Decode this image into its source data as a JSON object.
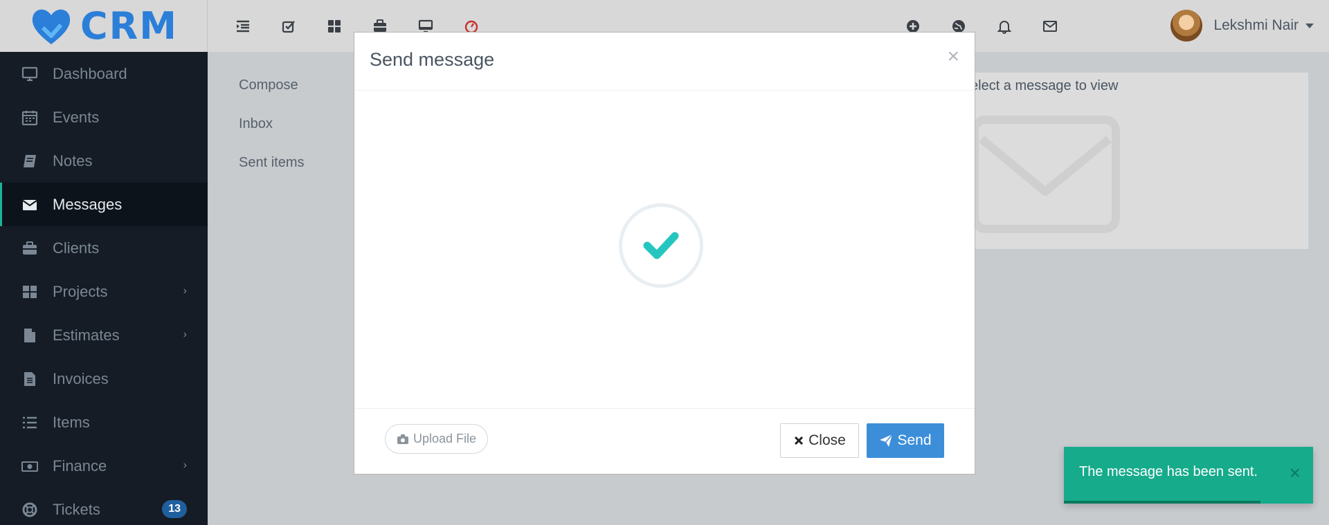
{
  "brand": {
    "name": "CRM"
  },
  "topbar": {
    "left_icons": [
      "menu-icon",
      "check-square-icon",
      "grid-icon",
      "briefcase-icon",
      "monitor-icon",
      "timer-icon"
    ],
    "right_icons": [
      "plus-circle-icon",
      "globe-icon",
      "bell-icon",
      "envelope-icon"
    ],
    "user_name": "Lekshmi Nair"
  },
  "sidebar": {
    "items": [
      {
        "label": "Dashboard",
        "icon": "desktop-icon"
      },
      {
        "label": "Events",
        "icon": "calendar-icon"
      },
      {
        "label": "Notes",
        "icon": "book-icon"
      },
      {
        "label": "Messages",
        "icon": "envelope-icon",
        "active": true
      },
      {
        "label": "Clients",
        "icon": "briefcase-icon"
      },
      {
        "label": "Projects",
        "icon": "grid-icon",
        "arrow": "›"
      },
      {
        "label": "Estimates",
        "icon": "file-icon",
        "arrow": "›"
      },
      {
        "label": "Invoices",
        "icon": "file-text-icon"
      },
      {
        "label": "Items",
        "icon": "list-icon"
      },
      {
        "label": "Finance",
        "icon": "money-icon",
        "arrow": "›"
      },
      {
        "label": "Tickets",
        "icon": "lifebuoy-icon",
        "badge": "13"
      }
    ]
  },
  "messages_menu": {
    "compose": "Compose",
    "inbox": "Inbox",
    "sent": "Sent items"
  },
  "viewer": {
    "placeholder": "elect a message to view"
  },
  "modal": {
    "title": "Send message",
    "close_symbol": "×",
    "upload_label": "Upload File",
    "close_label": "Close",
    "send_label": "Send"
  },
  "toast": {
    "message": "The message has been sent.",
    "close_symbol": "×",
    "progress": 0.79
  },
  "colors": {
    "accent": "#1bb394",
    "primary": "#3c8ed9",
    "sidebar_bg": "#151c25",
    "toast_bg": "#16ab8b",
    "brand": "#2b7fd8",
    "check": "#26c6c0"
  }
}
